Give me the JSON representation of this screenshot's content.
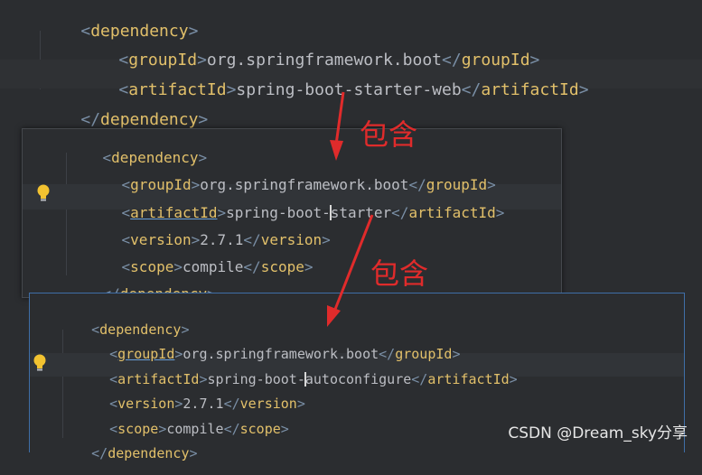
{
  "top": {
    "dep_open": "dependency",
    "group_tag": "groupId",
    "group_val": "org.springframework.boot",
    "artifact_tag": "artifactId",
    "artifact_val": "spring-boot-starter-web",
    "dep_close": "dependency"
  },
  "mid": {
    "dep_open": "dependency",
    "group_tag": "groupId",
    "group_val": "org.springframework.boot",
    "artifact_tag": "artifactId",
    "artifact_val_a": "spring-boot-",
    "artifact_val_b": "starter",
    "version_tag": "version",
    "version_val": "2.7.1",
    "scope_tag": "scope",
    "scope_val": "compile",
    "dep_close": "dependency"
  },
  "bot": {
    "dep_open": "dependency",
    "group_tag": "groupId",
    "group_val": "org.springframework.boot",
    "artifact_tag": "artifactId",
    "artifact_val_a": "spring-boot-",
    "artifact_val_b": "autoconfigure",
    "version_tag": "version",
    "version_val": "2.7.1",
    "scope_tag": "scope",
    "scope_val": "compile",
    "dep_close": "dependency"
  },
  "annotations": {
    "contains_1": "包含",
    "contains_2": "包含",
    "arrow_color": "#e02b2b"
  },
  "watermark": "CSDN @Dream_sky分享",
  "icons": [
    "lightbulb-icon",
    "arrow-icon"
  ]
}
